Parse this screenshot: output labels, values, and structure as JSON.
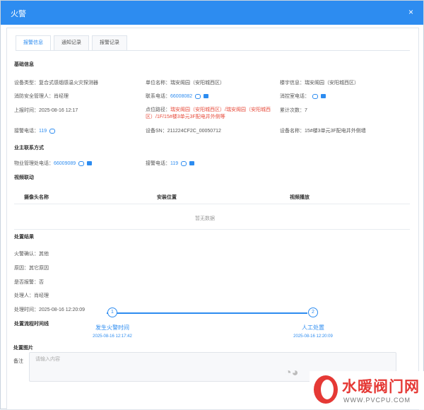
{
  "dialog": {
    "title": "火警",
    "close": "×"
  },
  "tabs": [
    {
      "label": "报警信息",
      "active": true
    },
    {
      "label": "通知记录",
      "active": false
    },
    {
      "label": "报警记录",
      "active": false
    }
  ],
  "basic": {
    "section": "基础信息",
    "device_type": "设备类型：复合式感烟感温火灾探测器",
    "unit_name": "单位名称：瑞安阁园（安阳城西区）",
    "building": "楼宇信息：瑞安阁园（安阳城西区）",
    "safety_manager": "消防安全管理人：肖经理",
    "contact_label": "联系电话：",
    "contact_phone": "66008082",
    "fire_contact_label": "消控室电话：",
    "report_time": "上报时间：2025-08-16 12:17",
    "location_label": "点位路径：",
    "location_value": "瑞安阁园（安阳城西区）/瑞安阁园（安阳城西区）/1F/15#楼3单元3F配电井外侧等",
    "count": "累计次数：7",
    "police_label": "接警电话：",
    "police_phone": "119",
    "device_sn": "设备SN：211224CF2C_00050712",
    "device_name": "设备名称：15#楼3单元3F配电井外侧墙"
  },
  "owner": {
    "section": "业主联系方式",
    "property_label": "物业管理处电话：",
    "property_phone": "66009089",
    "police_label": "接警电话：",
    "police_phone": "119"
  },
  "video": {
    "section": "视频联动",
    "columns": [
      "摄像头名称",
      "安装位置",
      "视频播放"
    ],
    "empty": "暂无数据"
  },
  "result": {
    "section": "处置结果",
    "rows": [
      "火警确认：其他",
      "原因：其它原因",
      "是否报警：否",
      "处理人：肖经理",
      "处理时间：2025-08-16 12:20:09"
    ]
  },
  "timeline": {
    "section": "处置流程时间线",
    "steps": [
      {
        "num": "1",
        "name": "发生火警时间",
        "time": "2025-08-16 12:17:42"
      },
      {
        "num": "2",
        "name": "人工处置",
        "time": "2025-08-16 12:20:09"
      }
    ]
  },
  "images": {
    "section": "处置图片"
  },
  "remark": {
    "label": "备注",
    "placeholder": "请输入内容"
  },
  "watermark": {
    "text": "水暖阀门网",
    "url": "WWW.PVCPU.COM"
  }
}
